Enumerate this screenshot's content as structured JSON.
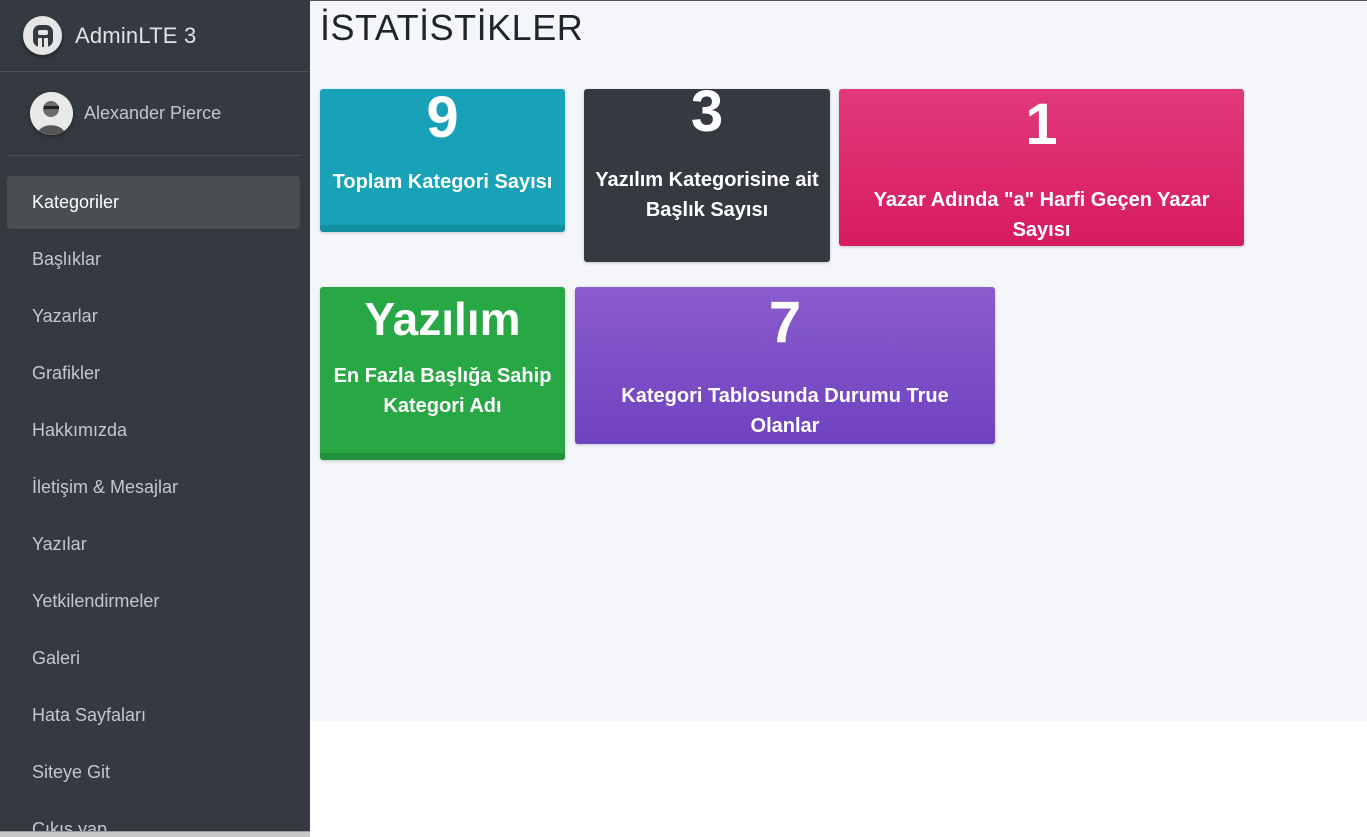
{
  "brand": {
    "name": "AdminLTE 3",
    "logo_icon": "adminlte-logo-icon"
  },
  "user": {
    "name": "Alexander Pierce"
  },
  "nav": {
    "items": [
      {
        "label": "Kategoriler",
        "active": true
      },
      {
        "label": "Başlıklar"
      },
      {
        "label": "Yazarlar"
      },
      {
        "label": "Grafikler"
      },
      {
        "label": "Hakkımızda"
      },
      {
        "label": "İletişim & Mesajlar"
      },
      {
        "label": "Yazılar"
      },
      {
        "label": "Yetkilendirmeler"
      },
      {
        "label": "Galeri"
      },
      {
        "label": "Hata Sayfaları"
      },
      {
        "label": "Siteye Git"
      },
      {
        "label": "Çıkış yap"
      }
    ]
  },
  "page": {
    "title": "İSTATİSTİKLER"
  },
  "stats": [
    {
      "value": "9",
      "label": "Toplam Kategori Sayısı",
      "color": "#17a2b8"
    },
    {
      "value": "3",
      "label": "Yazılım Kategorisine ait Başlık Sayısı",
      "color": "#343a40"
    },
    {
      "value": "1",
      "label": "Yazar Adında \"a\" Harfi Geçen Yazar Sayısı",
      "color": "#d81b60"
    },
    {
      "value": "Yazılım",
      "label": "En Fazla Başlığa Sahip Kategori Adı",
      "color": "#28a745"
    },
    {
      "value": "7",
      "label": "Kategori Tablosunda Durumu True Olanlar",
      "color": "#6f42c1"
    }
  ]
}
